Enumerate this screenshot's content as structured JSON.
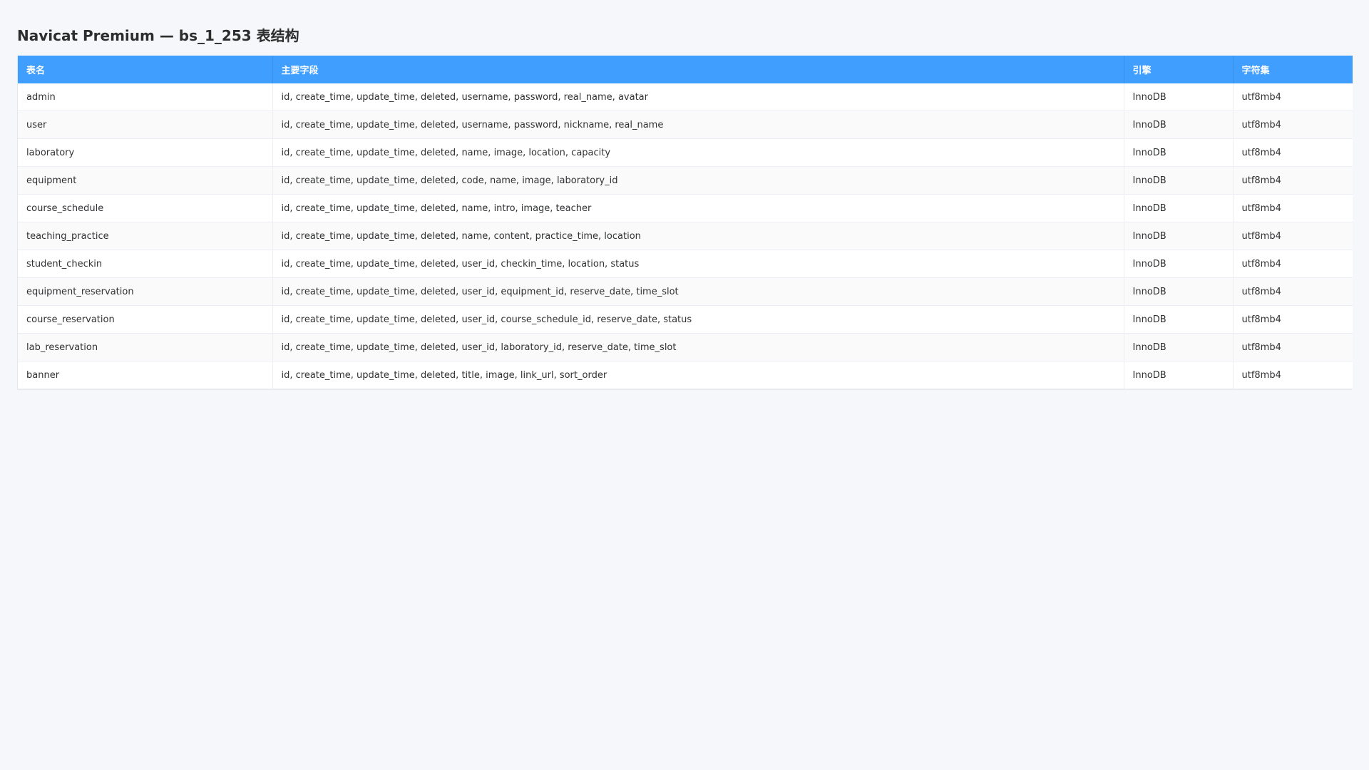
{
  "window": {
    "title": "Navicat Premium — bs_1_253 表结构"
  },
  "table": {
    "headers": {
      "name": "表名",
      "fields": "主要字段",
      "engine": "引擎",
      "charset": "字符集"
    },
    "rows": [
      {
        "name": "admin",
        "fields": "id, create_time, update_time, deleted, username, password, real_name, avatar",
        "engine": "InnoDB",
        "charset": "utf8mb4"
      },
      {
        "name": "user",
        "fields": "id, create_time, update_time, deleted, username, password, nickname, real_name",
        "engine": "InnoDB",
        "charset": "utf8mb4"
      },
      {
        "name": "laboratory",
        "fields": "id, create_time, update_time, deleted, name, image, location, capacity",
        "engine": "InnoDB",
        "charset": "utf8mb4"
      },
      {
        "name": "equipment",
        "fields": "id, create_time, update_time, deleted, code, name, image, laboratory_id",
        "engine": "InnoDB",
        "charset": "utf8mb4"
      },
      {
        "name": "course_schedule",
        "fields": "id, create_time, update_time, deleted, name, intro, image, teacher",
        "engine": "InnoDB",
        "charset": "utf8mb4"
      },
      {
        "name": "teaching_practice",
        "fields": "id, create_time, update_time, deleted, name, content, practice_time, location",
        "engine": "InnoDB",
        "charset": "utf8mb4"
      },
      {
        "name": "student_checkin",
        "fields": "id, create_time, update_time, deleted, user_id, checkin_time, location, status",
        "engine": "InnoDB",
        "charset": "utf8mb4"
      },
      {
        "name": "equipment_reservation",
        "fields": "id, create_time, update_time, deleted, user_id, equipment_id, reserve_date, time_slot",
        "engine": "InnoDB",
        "charset": "utf8mb4"
      },
      {
        "name": "course_reservation",
        "fields": "id, create_time, update_time, deleted, user_id, course_schedule_id, reserve_date, status",
        "engine": "InnoDB",
        "charset": "utf8mb4"
      },
      {
        "name": "lab_reservation",
        "fields": "id, create_time, update_time, deleted, user_id, laboratory_id, reserve_date, time_slot",
        "engine": "InnoDB",
        "charset": "utf8mb4"
      },
      {
        "name": "banner",
        "fields": "id, create_time, update_time, deleted, title, image, link_url, sort_order",
        "engine": "InnoDB",
        "charset": "utf8mb4"
      }
    ]
  },
  "colors": {
    "header_bg": "#409eff",
    "page_bg": "#f5f7fa",
    "row_alt": "#fafafa"
  }
}
